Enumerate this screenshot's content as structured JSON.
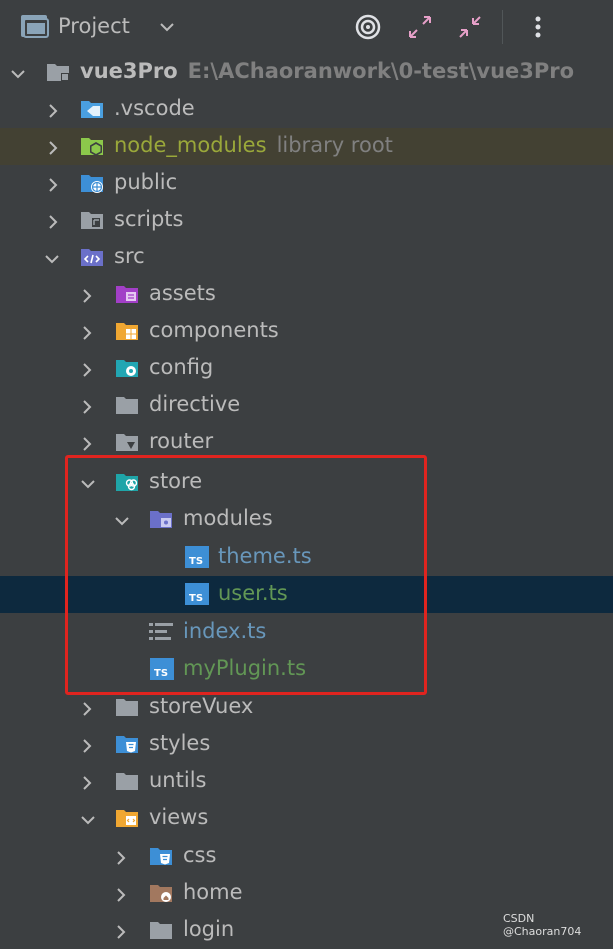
{
  "toolbar": {
    "title": "Project",
    "icons": [
      "folder-icon",
      "chevron-down-icon",
      "locate-icon",
      "expand-icon",
      "collapse-icon",
      "more-icon"
    ]
  },
  "tree": {
    "root": {
      "label": "vue3Pro",
      "path": "E:\\AChaoranwork\\0-test\\vue3Pro"
    },
    "vscode": {
      "label": ".vscode"
    },
    "node_modules": {
      "label": "node_modules",
      "sub": "library root"
    },
    "public": {
      "label": "public"
    },
    "scripts": {
      "label": "scripts"
    },
    "src": {
      "label": "src"
    },
    "assets": {
      "label": "assets"
    },
    "components": {
      "label": "components"
    },
    "config": {
      "label": "config"
    },
    "directive": {
      "label": "directive"
    },
    "router": {
      "label": "router"
    },
    "store": {
      "label": "store"
    },
    "modules": {
      "label": "modules"
    },
    "theme_ts": {
      "label": "theme.ts"
    },
    "user_ts": {
      "label": "user.ts"
    },
    "index_ts": {
      "label": "index.ts"
    },
    "myPlugin_ts": {
      "label": "myPlugin.ts"
    },
    "storeVuex": {
      "label": "storeVuex"
    },
    "styles": {
      "label": "styles"
    },
    "untils": {
      "label": "untils"
    },
    "views": {
      "label": "views"
    },
    "css": {
      "label": "css"
    },
    "home": {
      "label": "home"
    },
    "login": {
      "label": "login"
    }
  },
  "ts_badge": "TS",
  "watermark": "CSDN @Chaoran704",
  "colors": {
    "background": "#3c3f41",
    "selection": "#0d293e",
    "library_row": "#434133",
    "highlight_box": "#e0241f",
    "ts_blue": "#6897bb",
    "ts_green": "#629755"
  }
}
